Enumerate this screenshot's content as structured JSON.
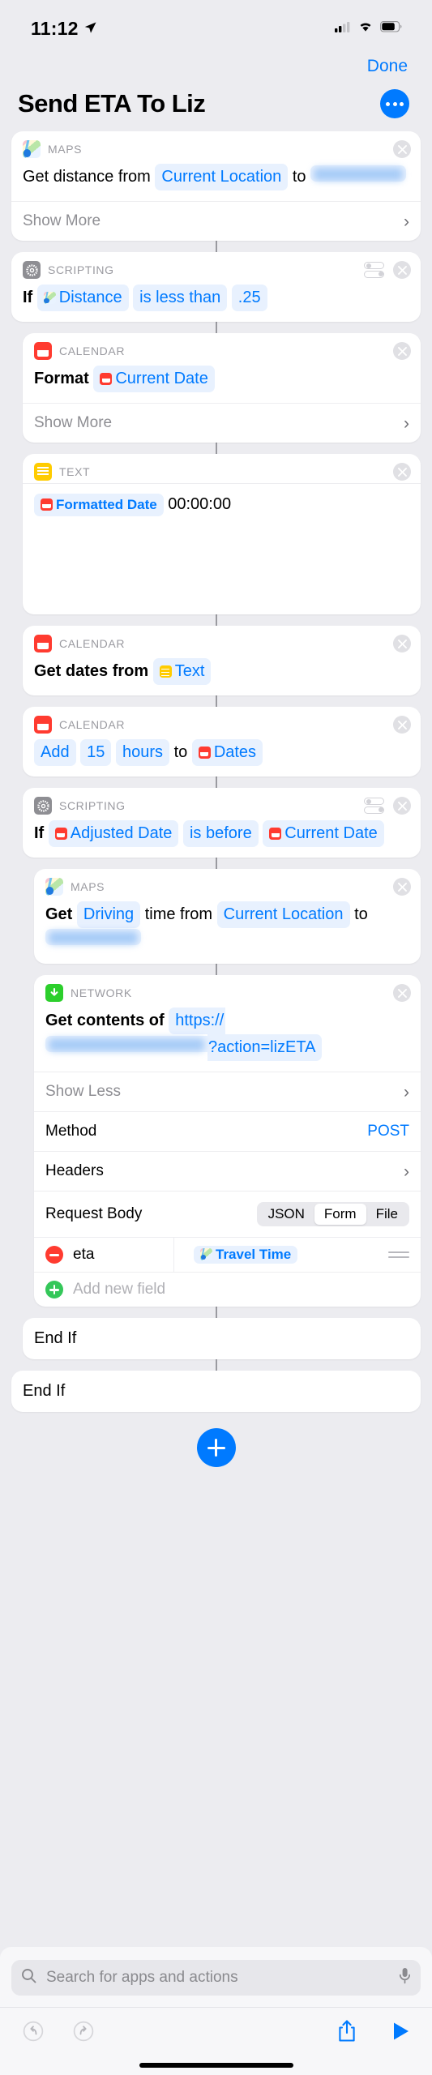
{
  "status_bar": {
    "time": "11:12",
    "location_icon": "location-arrow-icon",
    "cellular_icon": "cellular-signal-icon",
    "wifi_icon": "wifi-icon",
    "battery_icon": "battery-icon"
  },
  "nav": {
    "done_label": "Done"
  },
  "header": {
    "title": "Send ETA To Liz",
    "more_icon": "ellipsis-icon"
  },
  "actions": [
    {
      "category": "MAPS",
      "icon": "maps-icon",
      "indent": 0,
      "has_toggle": false,
      "body": [
        {
          "type": "text",
          "value": "Get distance from"
        },
        {
          "type": "token",
          "value": "Current Location"
        },
        {
          "type": "text",
          "value": "to"
        },
        {
          "type": "token",
          "value": "",
          "redacted": true
        }
      ],
      "footer": {
        "label": "Show More",
        "chevron": "chevron-right-icon"
      }
    },
    {
      "category": "SCRIPTING",
      "icon": "gear-icon",
      "indent": 0,
      "has_toggle": true,
      "body": [
        {
          "type": "text",
          "value": "If"
        },
        {
          "type": "token",
          "value": "Distance",
          "mini_icon": "maps-icon"
        },
        {
          "type": "token",
          "value": "is less than"
        },
        {
          "type": "token",
          "value": ".25"
        }
      ]
    },
    {
      "category": "CALENDAR",
      "icon": "calendar-icon",
      "indent": 1,
      "has_toggle": false,
      "body": [
        {
          "type": "text",
          "value": "Format"
        },
        {
          "type": "token",
          "value": "Current Date",
          "mini_icon": "calendar-icon"
        }
      ],
      "footer": {
        "label": "Show More",
        "chevron": "chevron-right-icon"
      }
    },
    {
      "category": "TEXT",
      "icon": "text-icon",
      "indent": 1,
      "has_toggle": false,
      "tall": true,
      "body": [
        {
          "type": "token",
          "value": "Formatted Date",
          "mini_icon": "calendar-icon",
          "bold": true
        },
        {
          "type": "text",
          "value": "00:00:00"
        }
      ]
    },
    {
      "category": "CALENDAR",
      "icon": "calendar-icon",
      "indent": 1,
      "has_toggle": false,
      "body": [
        {
          "type": "text",
          "value": "Get dates from"
        },
        {
          "type": "token",
          "value": "Text",
          "mini_icon": "text-icon"
        }
      ]
    },
    {
      "category": "CALENDAR",
      "icon": "calendar-icon",
      "indent": 1,
      "has_toggle": false,
      "body": [
        {
          "type": "token",
          "value": "Add"
        },
        {
          "type": "token",
          "value": "15"
        },
        {
          "type": "token",
          "value": "hours"
        },
        {
          "type": "text",
          "value": "to"
        },
        {
          "type": "token",
          "value": "Dates",
          "mini_icon": "calendar-icon"
        }
      ]
    },
    {
      "category": "SCRIPTING",
      "icon": "gear-icon",
      "indent": 1,
      "has_toggle": true,
      "body": [
        {
          "type": "text",
          "value": "If"
        },
        {
          "type": "token",
          "value": "Adjusted Date",
          "mini_icon": "calendar-icon"
        },
        {
          "type": "token",
          "value": "is before"
        },
        {
          "type": "token",
          "value": "Current Date",
          "mini_icon": "calendar-icon"
        }
      ]
    },
    {
      "category": "MAPS",
      "icon": "maps-icon",
      "indent": 2,
      "has_toggle": false,
      "body": [
        {
          "type": "text",
          "value": "Get"
        },
        {
          "type": "token",
          "value": "Driving"
        },
        {
          "type": "text",
          "value": "time from"
        },
        {
          "type": "token",
          "value": "Current Location"
        },
        {
          "type": "text",
          "value": "to"
        },
        {
          "type": "token",
          "value": "",
          "redacted": true
        }
      ]
    }
  ],
  "network_action": {
    "category": "NETWORK",
    "icon": "network-download-icon",
    "prefix": "Get contents of",
    "url_visible_prefix": "https://",
    "url_redacted": true,
    "url_visible_suffix": "?action=lizETA",
    "show_less_label": "Show Less",
    "rows": [
      {
        "label": "Method",
        "value": "POST",
        "kind": "value"
      },
      {
        "label": "Headers",
        "value": "",
        "kind": "chevron"
      }
    ],
    "request_body": {
      "label": "Request Body",
      "options": [
        "JSON",
        "Form",
        "File"
      ],
      "selected": "Form"
    },
    "fields": [
      {
        "key": "eta",
        "value": "Travel Time",
        "value_icon": "maps-icon",
        "remove_icon": "minus-circle-icon",
        "drag_icon": "drag-handle-icon"
      }
    ],
    "add_field_label": "Add new field",
    "add_field_icon": "plus-circle-icon"
  },
  "end_blocks": [
    {
      "label": "End If",
      "indent": 1
    },
    {
      "label": "End If",
      "indent": 0
    }
  ],
  "add_action": {
    "icon": "plus-icon"
  },
  "search": {
    "placeholder": "Search for apps and actions",
    "value": "",
    "search_icon": "search-icon",
    "mic_icon": "microphone-icon"
  },
  "toolbar": {
    "undo_icon": "undo-icon",
    "redo_icon": "redo-icon",
    "share_icon": "share-icon",
    "play_icon": "play-icon"
  },
  "colors": {
    "accent": "#007aff",
    "background": "#ececf0",
    "card": "#ffffff",
    "token_bg": "#e8f1fe",
    "calendar_red": "#ff3b30",
    "text_yellow": "#ffcc00",
    "network_green": "#2ccf2c",
    "scripting_gray": "#8e8e93",
    "minus_red": "#ff3b30",
    "plus_green": "#34c759"
  }
}
